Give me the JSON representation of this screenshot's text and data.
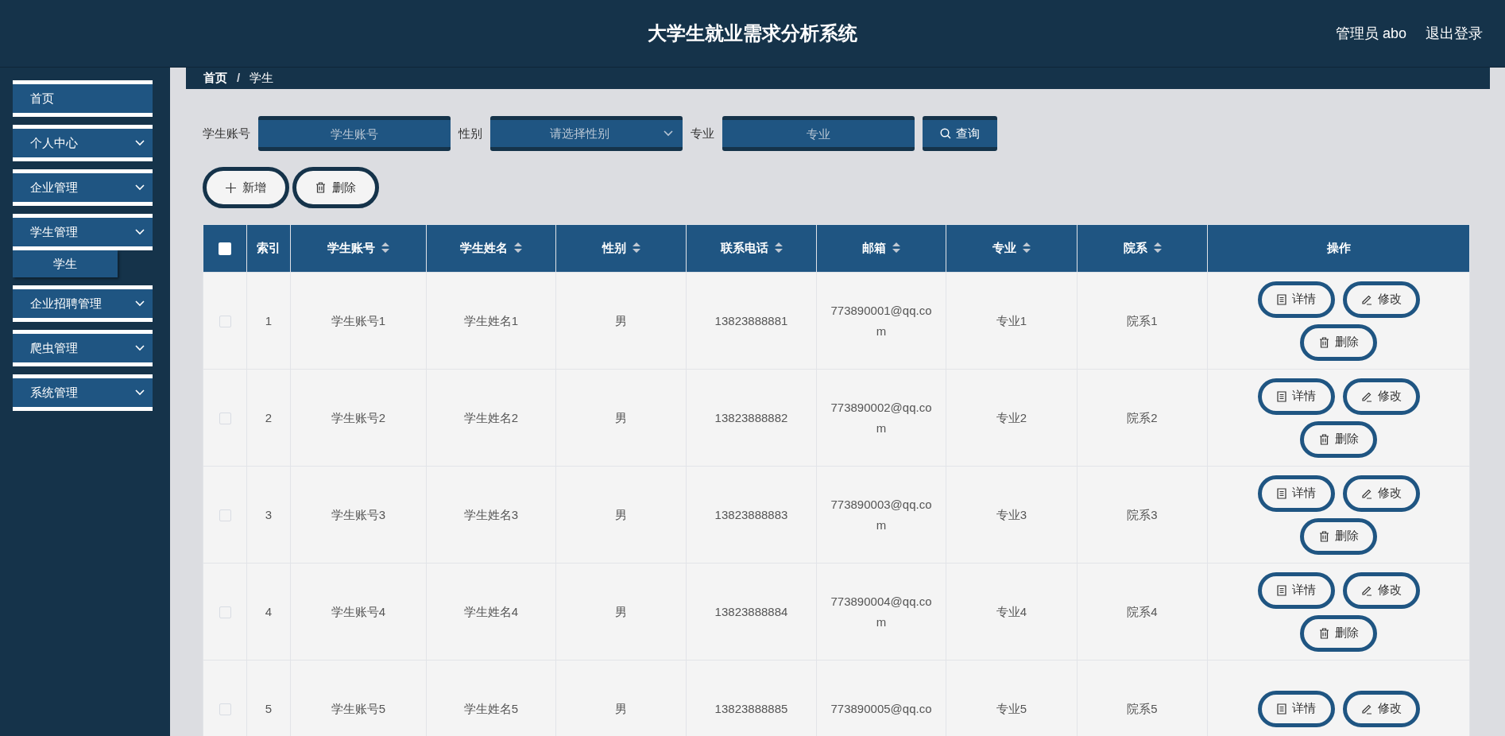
{
  "header": {
    "title": "大学生就业需求分析系统",
    "user": "管理员 abo",
    "logout": "退出登录"
  },
  "sidebar": {
    "items": [
      {
        "label": "首页",
        "expandable": false
      },
      {
        "label": "个人中心",
        "expandable": true
      },
      {
        "label": "企业管理",
        "expandable": true
      },
      {
        "label": "学生管理",
        "expandable": true,
        "children": [
          {
            "label": "学生"
          }
        ]
      },
      {
        "label": "企业招聘管理",
        "expandable": true
      },
      {
        "label": "爬虫管理",
        "expandable": true
      },
      {
        "label": "系统管理",
        "expandable": true
      }
    ]
  },
  "breadcrumb": {
    "items": [
      "首页",
      "学生"
    ],
    "separator": "/"
  },
  "search": {
    "fields": [
      {
        "kind": "text",
        "label": "学生账号",
        "placeholder": "学生账号"
      },
      {
        "kind": "select",
        "label": "性别",
        "placeholder": "请选择性别"
      },
      {
        "kind": "text",
        "label": "专业",
        "placeholder": "专业"
      }
    ],
    "button": "查询"
  },
  "actions": [
    {
      "kind": "add",
      "label": "新增"
    },
    {
      "kind": "delete",
      "label": "删除"
    }
  ],
  "table": {
    "all_checked": false,
    "columns": [
      {
        "label": "索引",
        "sortable": false
      },
      {
        "label": "学生账号",
        "sortable": true
      },
      {
        "label": "学生姓名",
        "sortable": true
      },
      {
        "label": "性别",
        "sortable": true
      },
      {
        "label": "联系电话",
        "sortable": true
      },
      {
        "label": "邮箱",
        "sortable": true
      },
      {
        "label": "专业",
        "sortable": true
      },
      {
        "label": "院系",
        "sortable": true
      },
      {
        "label": "操作",
        "sortable": false
      }
    ],
    "rows": [
      {
        "checked": false,
        "cells": [
          "1",
          "学生账号1",
          "学生姓名1",
          "男",
          "13823888881",
          "773890001@qq.com",
          "专业1",
          "院系1"
        ],
        "actions": [
          {
            "kind": "detail",
            "label": "详情"
          },
          {
            "kind": "edit",
            "label": "修改"
          },
          {
            "kind": "delete",
            "label": "删除"
          }
        ]
      },
      {
        "checked": false,
        "cells": [
          "2",
          "学生账号2",
          "学生姓名2",
          "男",
          "13823888882",
          "773890002@qq.com",
          "专业2",
          "院系2"
        ],
        "actions": [
          {
            "kind": "detail",
            "label": "详情"
          },
          {
            "kind": "edit",
            "label": "修改"
          },
          {
            "kind": "delete",
            "label": "删除"
          }
        ]
      },
      {
        "checked": false,
        "cells": [
          "3",
          "学生账号3",
          "学生姓名3",
          "男",
          "13823888883",
          "773890003@qq.com",
          "专业3",
          "院系3"
        ],
        "actions": [
          {
            "kind": "detail",
            "label": "详情"
          },
          {
            "kind": "edit",
            "label": "修改"
          },
          {
            "kind": "delete",
            "label": "删除"
          }
        ]
      },
      {
        "checked": false,
        "cells": [
          "4",
          "学生账号4",
          "学生姓名4",
          "男",
          "13823888884",
          "773890004@qq.com",
          "专业4",
          "院系4"
        ],
        "actions": [
          {
            "kind": "detail",
            "label": "详情"
          },
          {
            "kind": "edit",
            "label": "修改"
          },
          {
            "kind": "delete",
            "label": "删除"
          }
        ]
      },
      {
        "checked": false,
        "cells": [
          "5",
          "学生账号5",
          "学生姓名5",
          "男",
          "13823888885",
          "773890005@qq.co",
          "专业5",
          "院系5"
        ],
        "actions": [
          {
            "kind": "detail",
            "label": "详情"
          },
          {
            "kind": "edit",
            "label": "修改"
          }
        ]
      }
    ]
  }
}
